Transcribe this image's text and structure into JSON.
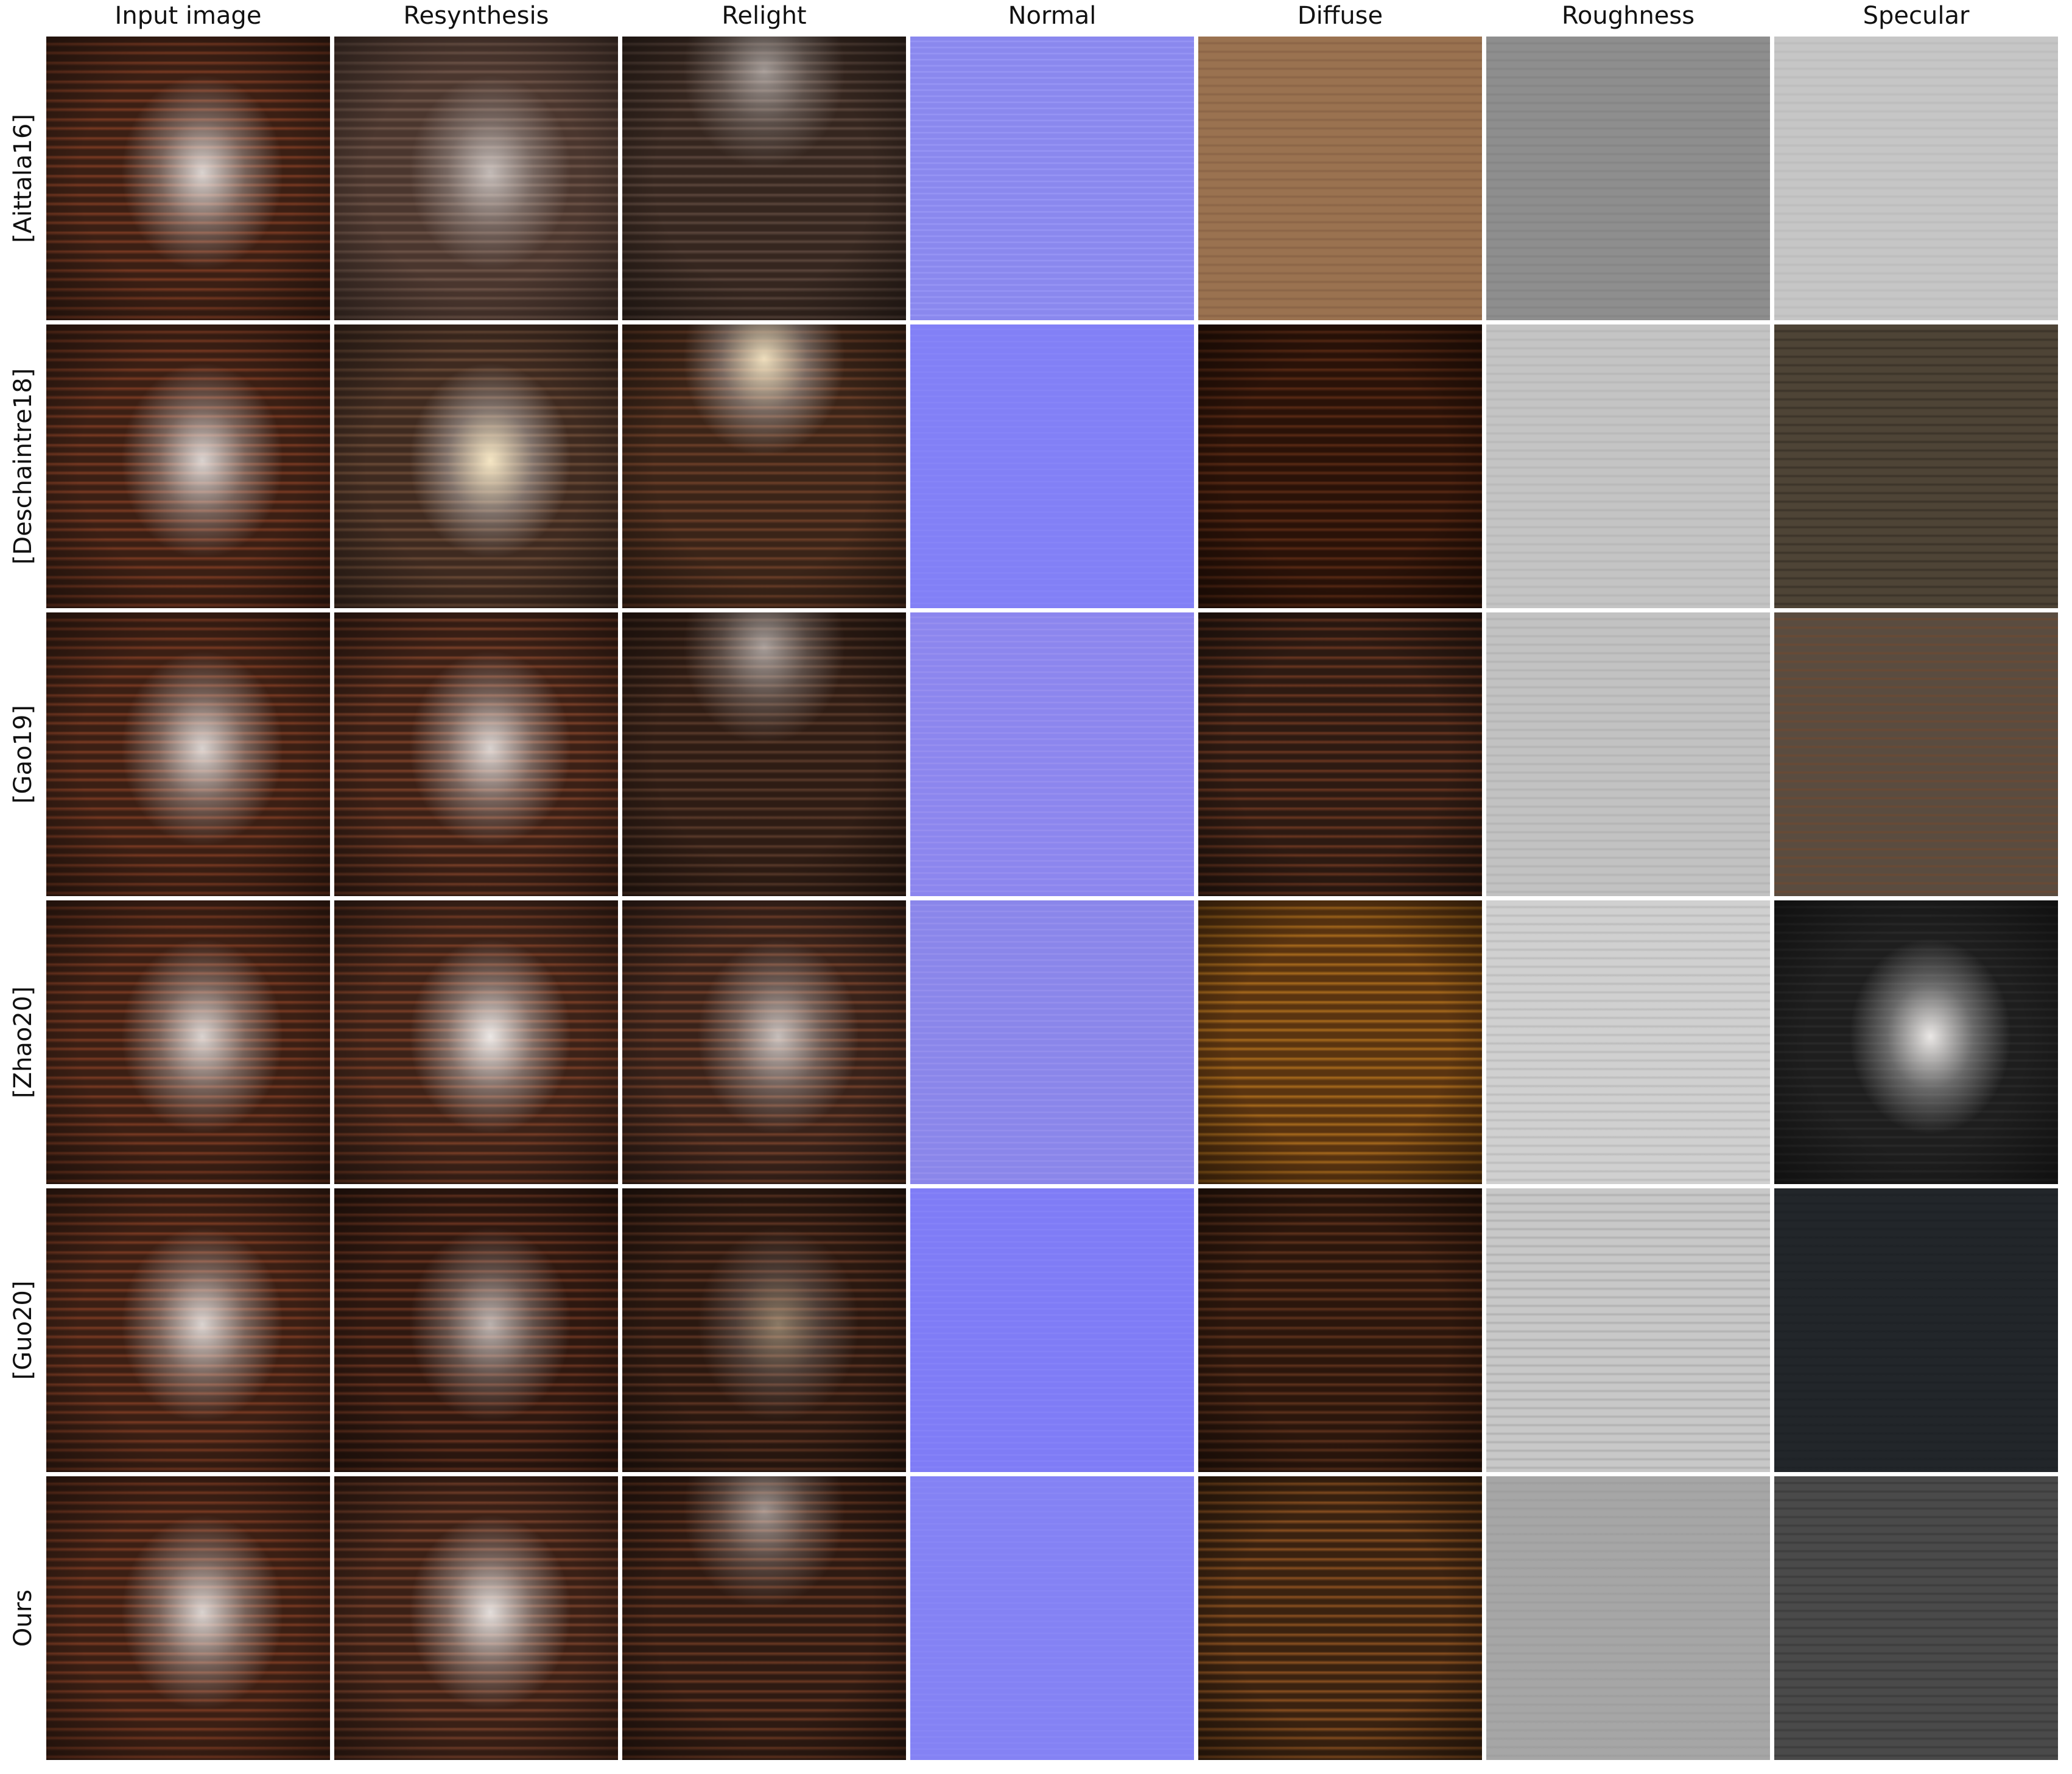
{
  "columns": [
    {
      "label": "Input image"
    },
    {
      "label": "Resynthesis"
    },
    {
      "label": "Relight"
    },
    {
      "label": "Normal"
    },
    {
      "label": "Diffuse"
    },
    {
      "label": "Roughness"
    },
    {
      "label": "Specular"
    }
  ],
  "rows": [
    {
      "label": "[Aittala16]",
      "tiles": [
        {
          "tone": "wood",
          "base": "#3b1f14",
          "stripe": "#7a3a22",
          "spec": 0.85,
          "spot": "center"
        },
        {
          "tone": "wood",
          "base": "#4a362e",
          "stripe": "#6e5448",
          "spec": 0.7,
          "spot": "center"
        },
        {
          "tone": "wood",
          "base": "#35261f",
          "stripe": "#5b463c",
          "spec": 0.55,
          "spot": "top"
        },
        {
          "tone": "normal",
          "base": "#8a88ee",
          "stripe": "#9a98f6",
          "spec": 0,
          "spot": "none"
        },
        {
          "tone": "flat",
          "base": "#9a7250",
          "stripe": "#8a6446",
          "spec": 0,
          "spot": "none"
        },
        {
          "tone": "flat",
          "base": "#8e8e8e",
          "stripe": "#858585",
          "spec": 0,
          "spot": "none"
        },
        {
          "tone": "flat",
          "base": "#c6c6c6",
          "stripe": "#bcbcbc",
          "spec": 0,
          "spot": "none"
        }
      ]
    },
    {
      "label": "[Deschaintre18]",
      "tiles": [
        {
          "tone": "wood",
          "base": "#3b1f14",
          "stripe": "#7a3a22",
          "spec": 0.85,
          "spot": "center"
        },
        {
          "tone": "wood",
          "base": "#3e2a20",
          "stripe": "#6b4a36",
          "spec": 0.95,
          "spot": "center-warm"
        },
        {
          "tone": "wood",
          "base": "#3a2418",
          "stripe": "#6d3f28",
          "spec": 0.9,
          "spot": "top-warm"
        },
        {
          "tone": "normal",
          "base": "#8280f6",
          "stripe": "#8886f8",
          "spec": 0,
          "spot": "none"
        },
        {
          "tone": "wood",
          "base": "#2a1208",
          "stripe": "#5a2a14",
          "spec": 0,
          "spot": "none"
        },
        {
          "tone": "flat",
          "base": "#c4c4c4",
          "stripe": "#b8b8b8",
          "spec": 0,
          "spot": "none"
        },
        {
          "tone": "flat",
          "base": "#4e4436",
          "stripe": "#3a3228",
          "spec": 0,
          "spot": "none"
        }
      ]
    },
    {
      "label": "[Gao19]",
      "tiles": [
        {
          "tone": "wood",
          "base": "#3b1f14",
          "stripe": "#7a3a22",
          "spec": 0.85,
          "spot": "center"
        },
        {
          "tone": "wood",
          "base": "#3b2016",
          "stripe": "#7b4028",
          "spec": 0.85,
          "spot": "center"
        },
        {
          "tone": "wood",
          "base": "#2e1c14",
          "stripe": "#5a3a2a",
          "spec": 0.6,
          "spot": "top"
        },
        {
          "tone": "normal",
          "base": "#8c86ee",
          "stripe": "#9a92f0",
          "spec": 0,
          "spot": "none"
        },
        {
          "tone": "wood",
          "base": "#2d1a12",
          "stripe": "#6a3620",
          "spec": 0,
          "spot": "none"
        },
        {
          "tone": "flat",
          "base": "#c2c2c2",
          "stripe": "#b4b4b4",
          "spec": 0,
          "spot": "none"
        },
        {
          "tone": "flat",
          "base": "#5a4c40",
          "stripe": "#6b4a34",
          "spec": 0,
          "spot": "none"
        }
      ]
    },
    {
      "label": "[Zhao20]",
      "tiles": [
        {
          "tone": "wood",
          "base": "#3b1f14",
          "stripe": "#7a3a22",
          "spec": 0.85,
          "spot": "center"
        },
        {
          "tone": "wood",
          "base": "#3c2218",
          "stripe": "#7a3e26",
          "spec": 0.95,
          "spot": "center"
        },
        {
          "tone": "wood",
          "base": "#38221a",
          "stripe": "#73402a",
          "spec": 0.75,
          "spot": "center"
        },
        {
          "tone": "normal",
          "base": "#8a86ea",
          "stripe": "#9892ee",
          "spec": 0,
          "spot": "none"
        },
        {
          "tone": "wood",
          "base": "#5a3410",
          "stripe": "#a86a1c",
          "spec": 0,
          "spot": "none"
        },
        {
          "tone": "flat",
          "base": "#d0d0d0",
          "stripe": "#bcbcbc",
          "spec": 0,
          "spot": "none"
        },
        {
          "tone": "gray-spot",
          "base": "#1e1e1e",
          "stripe": "#2a2a2a",
          "spec": 0.95,
          "spot": "center"
        }
      ]
    },
    {
      "label": "[Guo20]",
      "tiles": [
        {
          "tone": "wood",
          "base": "#3b1f14",
          "stripe": "#7a3a22",
          "spec": 0.85,
          "spot": "center"
        },
        {
          "tone": "wood",
          "base": "#2e1810",
          "stripe": "#6a3420",
          "spec": 0.7,
          "spot": "center"
        },
        {
          "tone": "wood",
          "base": "#2a1810",
          "stripe": "#5e3422",
          "spec": 0.45,
          "spot": "center-warm"
        },
        {
          "tone": "normal",
          "base": "#7f7cf6",
          "stripe": "#8784f8",
          "spec": 0,
          "spot": "none"
        },
        {
          "tone": "wood",
          "base": "#2b160c",
          "stripe": "#5e321c",
          "spec": 0,
          "spot": "none"
        },
        {
          "tone": "flat",
          "base": "#c8c8c8",
          "stripe": "#b0b0b0",
          "spec": 0,
          "spot": "none"
        },
        {
          "tone": "flat",
          "base": "#22262a",
          "stripe": "#1e2226",
          "spec": 0,
          "spot": "none"
        }
      ]
    },
    {
      "label": "Ours",
      "tiles": [
        {
          "tone": "wood",
          "base": "#3b1f14",
          "stripe": "#7a3a22",
          "spec": 0.85,
          "spot": "center"
        },
        {
          "tone": "wood",
          "base": "#3a2016",
          "stripe": "#76402a",
          "spec": 0.9,
          "spot": "center"
        },
        {
          "tone": "wood",
          "base": "#2e1a12",
          "stripe": "#6a3822",
          "spec": 0.55,
          "spot": "top"
        },
        {
          "tone": "normal",
          "base": "#8482f4",
          "stripe": "#8a88f6",
          "spec": 0,
          "spot": "none"
        },
        {
          "tone": "wood",
          "base": "#3a2210",
          "stripe": "#8a5020",
          "spec": 0,
          "spot": "none"
        },
        {
          "tone": "flat",
          "base": "#a6a6a6",
          "stripe": "#9e9e9e",
          "spec": 0,
          "spot": "none"
        },
        {
          "tone": "flat",
          "base": "#4a4a4a",
          "stripe": "#3c3c3c",
          "spec": 0,
          "spot": "none"
        }
      ]
    }
  ]
}
